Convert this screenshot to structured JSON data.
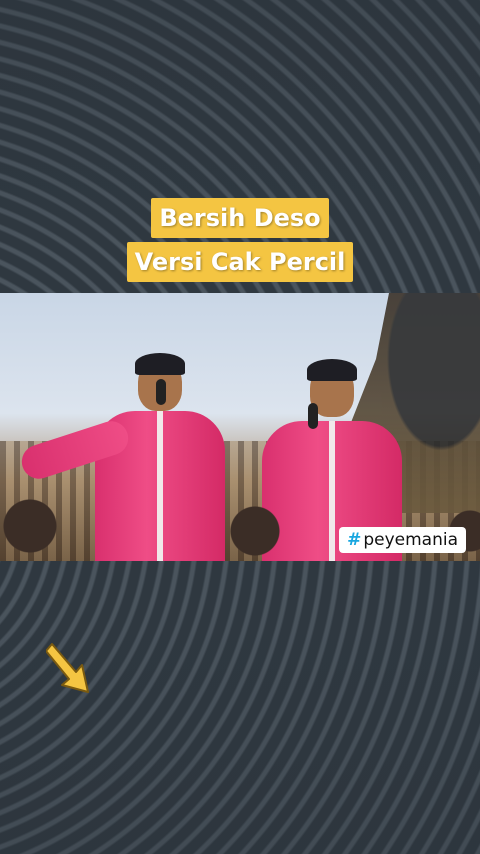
{
  "title": {
    "line1": "Bersih Deso",
    "line2": "Versi Cak Percil"
  },
  "video": {
    "hashtag_symbol": "#",
    "hashtag_text": "peyemania"
  },
  "icons": {
    "arrow": "arrow-down-right-icon"
  },
  "colors": {
    "title_bg": "#f4c542",
    "title_text": "#ffffff",
    "hashtag_accent": "#19a7e0",
    "costume": "#e23a78",
    "arrow": "#f4c542"
  }
}
